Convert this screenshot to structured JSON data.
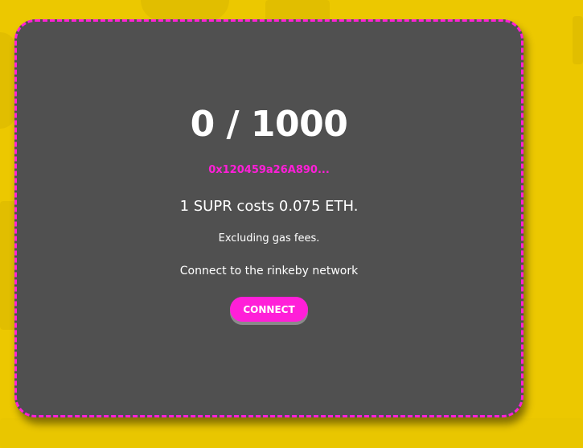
{
  "mint": {
    "counter": "0 / 1000",
    "contract_address": "0x120459a26A890...",
    "price_text": "1 SUPR costs 0.075 ETH.",
    "gas_note": "Excluding gas fees.",
    "network_note": "Connect to the rinkeby network",
    "connect_label": "CONNECT"
  },
  "colors": {
    "background": "#ecc800",
    "card": "#505050",
    "accent": "#ff1fd8",
    "text": "#ffffff"
  }
}
